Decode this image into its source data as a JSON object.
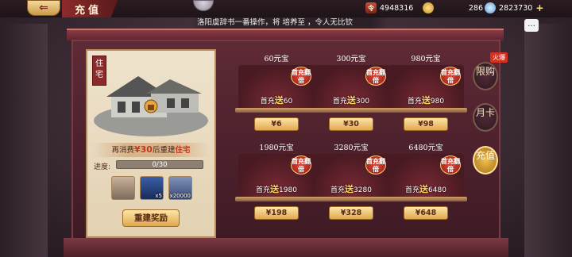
{
  "header": {
    "back_glyph": "⇐",
    "title": "充值"
  },
  "resources": {
    "token_value": "4948316",
    "gold_value": "286",
    "silver_value": "2823730",
    "plus": "+"
  },
  "marquee": {
    "text": "洛阳虞辞书一番操作，将 培养至 ，令人无比钦"
  },
  "chat": {
    "glyph": "…"
  },
  "house_panel": {
    "tag": "住宅",
    "cost_prefix": "再消费",
    "cost_amount": "¥30",
    "cost_mid": "后重建",
    "cost_target": "住宅",
    "progress_label": "进度:",
    "progress_text": "0/30",
    "progress_fraction": 0,
    "rewards": [
      {
        "name": "reward-scroll",
        "count": ""
      },
      {
        "name": "reward-blade",
        "count": "x5"
      },
      {
        "name": "reward-silver",
        "count": "x20000"
      }
    ],
    "rebuild_button": "重建奖励"
  },
  "packages": [
    {
      "name": "60元宝",
      "badge": "首充翻倍",
      "bonus_prefix": "首充",
      "bonus_song": "送",
      "bonus_amount": "60",
      "price": "¥6"
    },
    {
      "name": "300元宝",
      "badge": "首充翻倍",
      "bonus_prefix": "首充",
      "bonus_song": "送",
      "bonus_amount": "300",
      "price": "¥30"
    },
    {
      "name": "980元宝",
      "badge": "首充翻倍",
      "bonus_prefix": "首充",
      "bonus_song": "送",
      "bonus_amount": "980",
      "price": "¥98"
    },
    {
      "name": "1980元宝",
      "badge": "首充翻倍",
      "bonus_prefix": "首充",
      "bonus_song": "送",
      "bonus_amount": "1980",
      "price": "¥198"
    },
    {
      "name": "3280元宝",
      "badge": "首充翻倍",
      "bonus_prefix": "首充",
      "bonus_song": "送",
      "bonus_amount": "3280",
      "price": "¥328"
    },
    {
      "name": "6480元宝",
      "badge": "首充翻倍",
      "bonus_prefix": "首充",
      "bonus_song": "送",
      "bonus_amount": "6480",
      "price": "¥648"
    }
  ],
  "side_tabs": {
    "hot_label": "火爆",
    "limit": "限购",
    "monthly": "月卡",
    "recharge": "充值"
  }
}
